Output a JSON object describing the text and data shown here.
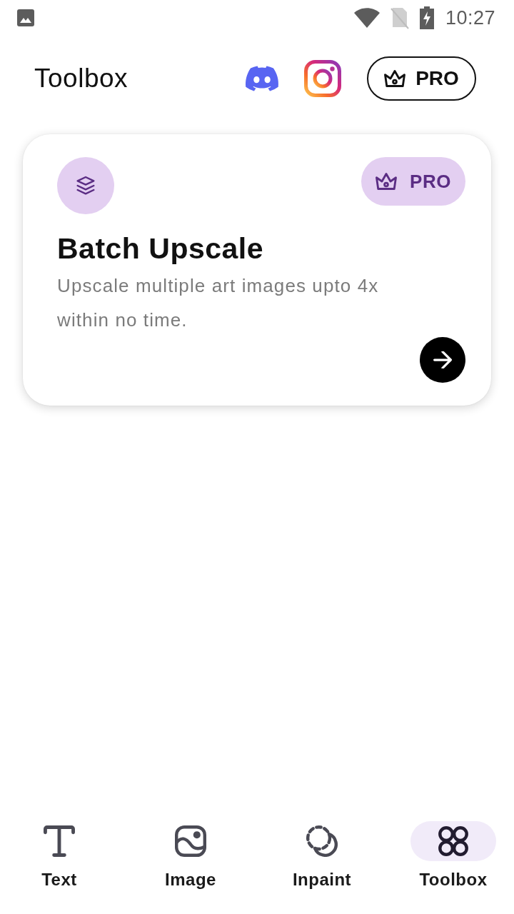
{
  "status_bar": {
    "time": "10:27"
  },
  "header": {
    "title": "Toolbox",
    "pro_button": {
      "label": "PRO"
    }
  },
  "card": {
    "badge": {
      "label": "PRO"
    },
    "title": "Batch Upscale",
    "description": "Upscale multiple art images upto 4x within no time."
  },
  "bottom_nav": [
    {
      "label": "Text",
      "selected": false
    },
    {
      "label": "Image",
      "selected": false
    },
    {
      "label": "Inpaint",
      "selected": false
    },
    {
      "label": "Toolbox",
      "selected": true
    }
  ]
}
